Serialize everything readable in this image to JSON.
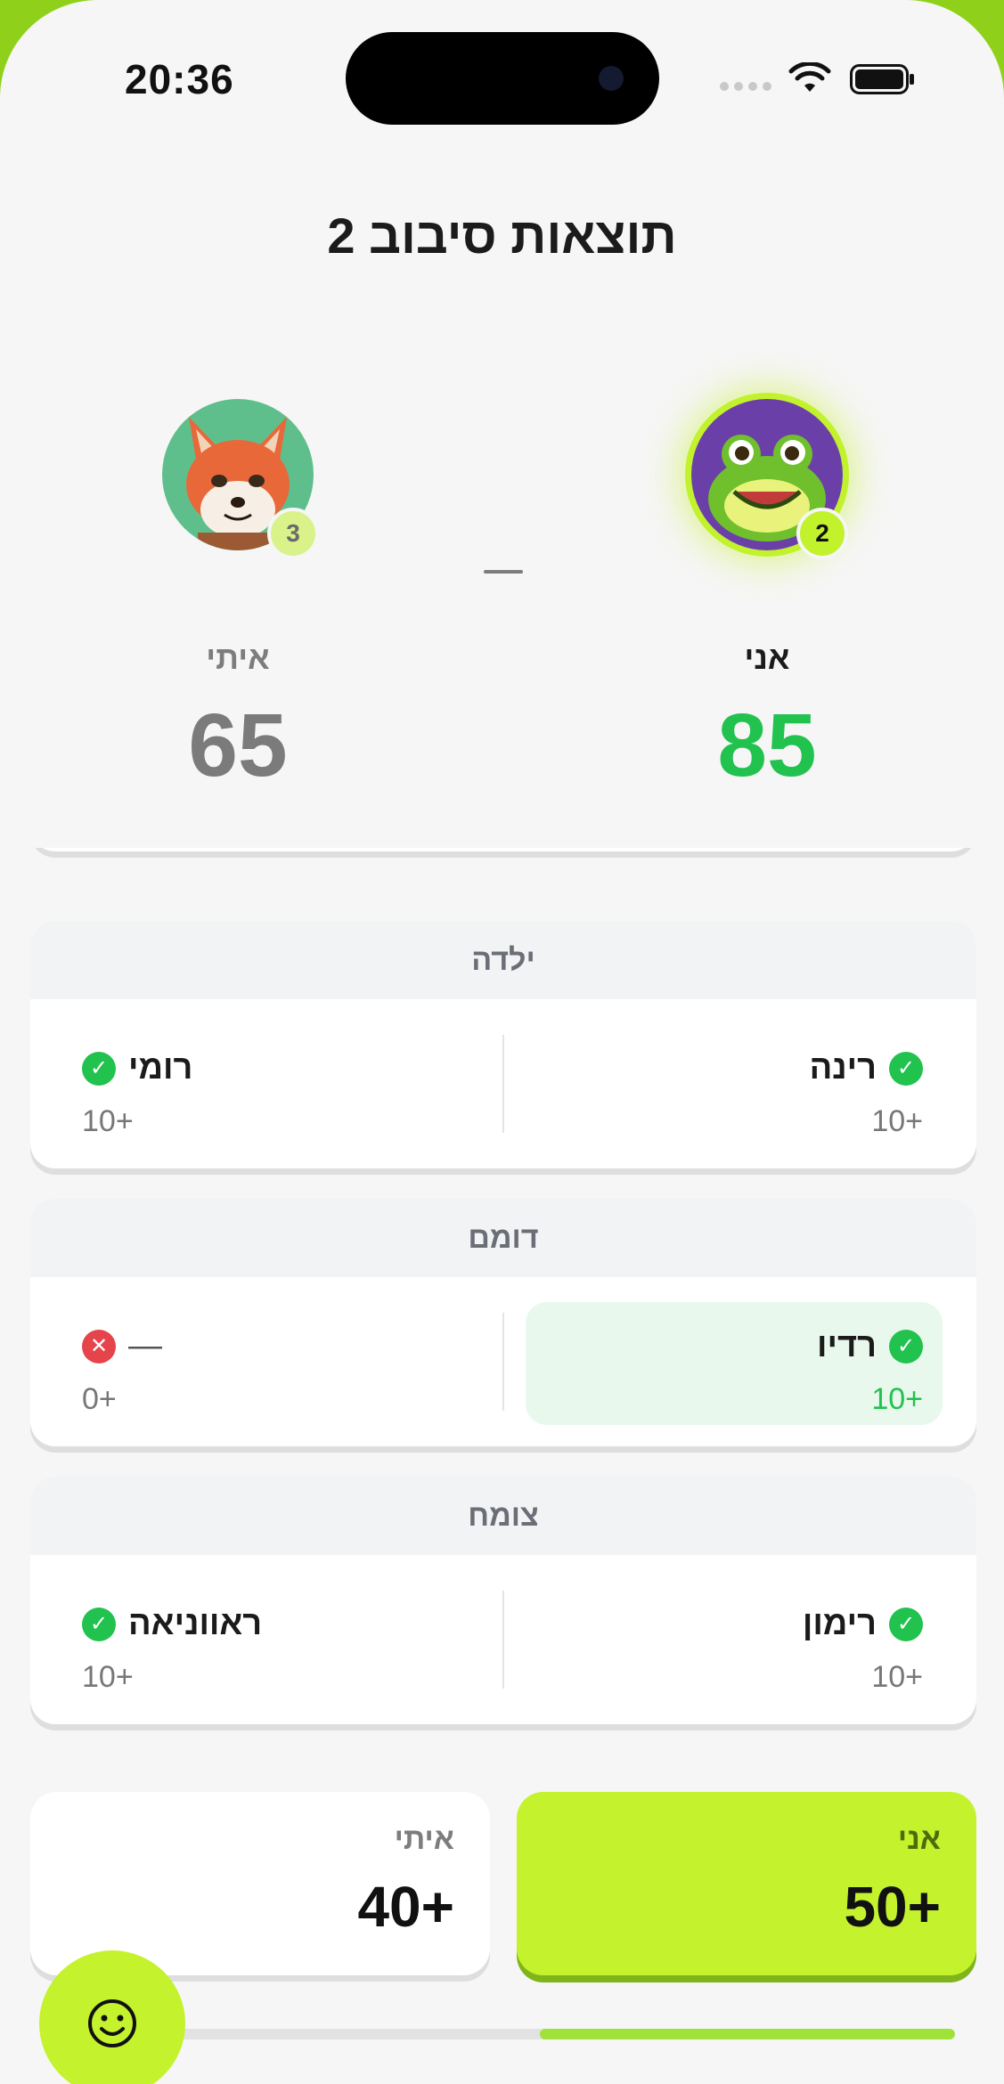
{
  "status_bar": {
    "time": "20:36",
    "icons": [
      "signal-dots-icon",
      "wifi-icon",
      "battery-icon"
    ]
  },
  "header": {
    "title": "תוצאות סיבוב 2"
  },
  "players": {
    "me": {
      "name": "אני",
      "score": "85",
      "rank": "2",
      "avatar": "frog-avatar"
    },
    "opponent": {
      "name": "איתי",
      "score": "65",
      "rank": "3",
      "avatar": "fox-avatar"
    },
    "separator": "—"
  },
  "categories": [
    {
      "title": "ילדה",
      "me": {
        "word": "רינה",
        "points": "10+",
        "correct": true,
        "highlight": false
      },
      "opponent": {
        "word": "רומי",
        "points": "10+",
        "correct": true
      }
    },
    {
      "title": "דומם",
      "me": {
        "word": "רדיו",
        "points": "10+",
        "correct": true,
        "highlight": true
      },
      "opponent": {
        "word": "—",
        "points": "0+",
        "correct": false
      }
    },
    {
      "title": "צומח",
      "me": {
        "word": "רימון",
        "points": "10+",
        "correct": true,
        "highlight": false
      },
      "opponent": {
        "word": "ראווניאה",
        "points": "10+",
        "correct": true
      }
    }
  ],
  "totals": {
    "me": {
      "label": "אני",
      "value": "50+"
    },
    "opponent": {
      "label": "איתי",
      "value": "40+"
    }
  },
  "progress": {
    "fraction": 0.5
  },
  "colors": {
    "accent": "#c4f22d",
    "correct": "#22c24f",
    "wrong": "#e5444a",
    "highlight_bg": "#e8f8ec"
  }
}
